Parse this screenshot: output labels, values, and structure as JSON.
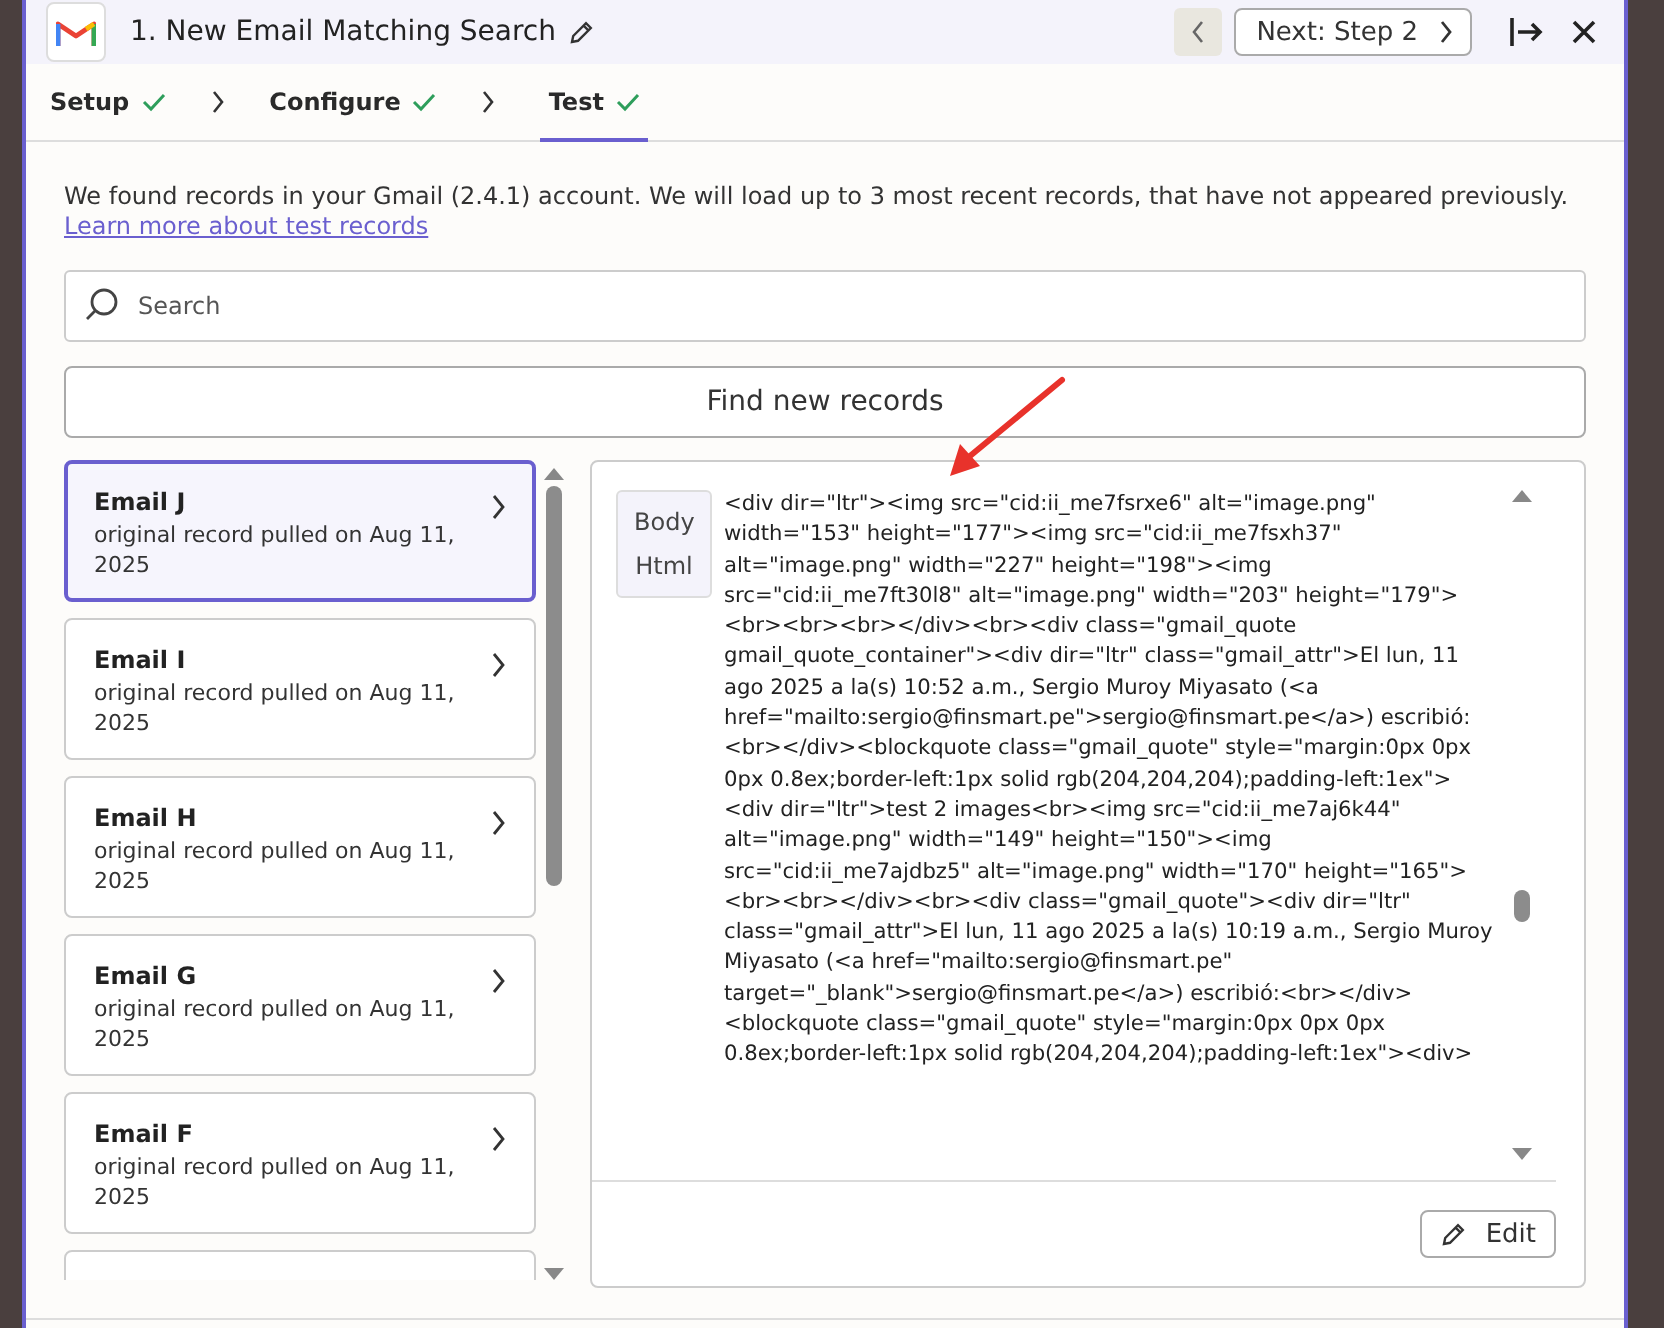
{
  "header": {
    "title": "1. New Email Matching Search",
    "next_button": "Next: Step 2"
  },
  "steps": [
    {
      "label": "Setup",
      "done": true,
      "selected": false
    },
    {
      "label": "Configure",
      "done": true,
      "selected": false
    },
    {
      "label": "Test",
      "done": true,
      "selected": true
    }
  ],
  "description": "We found records in your Gmail (2.4.1) account. We will load up to 3 most recent records, that have not appeared previously.",
  "learn_more_link": "Learn more about test records",
  "search": {
    "placeholder": "Search"
  },
  "find_button": "Find new records",
  "records": [
    {
      "title": "Email J",
      "subtitle": "original record pulled on Aug 11, 2025",
      "selected": true
    },
    {
      "title": "Email I",
      "subtitle": "original record pulled on Aug 11, 2025",
      "selected": false
    },
    {
      "title": "Email H",
      "subtitle": "original record pulled on Aug 11, 2025",
      "selected": false
    },
    {
      "title": "Email G",
      "subtitle": "original record pulled on Aug 11, 2025",
      "selected": false
    },
    {
      "title": "Email F",
      "subtitle": "original record pulled on Aug 11, 2025",
      "selected": false
    }
  ],
  "detail": {
    "field_label": "Body Html",
    "value": "<div dir=\"ltr\"><img src=\"cid:ii_me7fsrxe6\" alt=\"image.png\" width=\"153\" height=\"177\"><img src=\"cid:ii_me7fsxh37\" alt=\"image.png\" width=\"227\" height=\"198\"><img src=\"cid:ii_me7ft30l8\" alt=\"image.png\" width=\"203\" height=\"179\"><br><br><br></div><br><div class=\"gmail_quote gmail_quote_container\"><div dir=\"ltr\" class=\"gmail_attr\">El lun, 11 ago 2025 a la(s) 10:52 a.m., Sergio Muroy Miyasato (<a href=\"mailto:sergio@finsmart.pe\">sergio@finsmart.pe</a>) escribió:<br></div><blockquote class=\"gmail_quote\" style=\"margin:0px 0px 0px 0.8ex;border-left:1px solid rgb(204,204,204);padding-left:1ex\"><div dir=\"ltr\">test 2 images<br><img src=\"cid:ii_me7aj6k44\" alt=\"image.png\" width=\"149\" height=\"150\"><img src=\"cid:ii_me7ajdbz5\" alt=\"image.png\" width=\"170\" height=\"165\"><br><br></div><br><div class=\"gmail_quote\"><div dir=\"ltr\" class=\"gmail_attr\">El lun, 11 ago 2025 a la(s) 10:19 a.m., Sergio Muroy Miyasato (<a href=\"mailto:sergio@finsmart.pe\" target=\"_blank\">sergio@finsmart.pe</a>) escribió:<br></div><blockquote class=\"gmail_quote\" style=\"margin:0px 0px 0px 0.8ex;border-left:1px solid rgb(204,204,204);padding-left:1ex\"><div>",
    "edit_button": "Edit"
  }
}
